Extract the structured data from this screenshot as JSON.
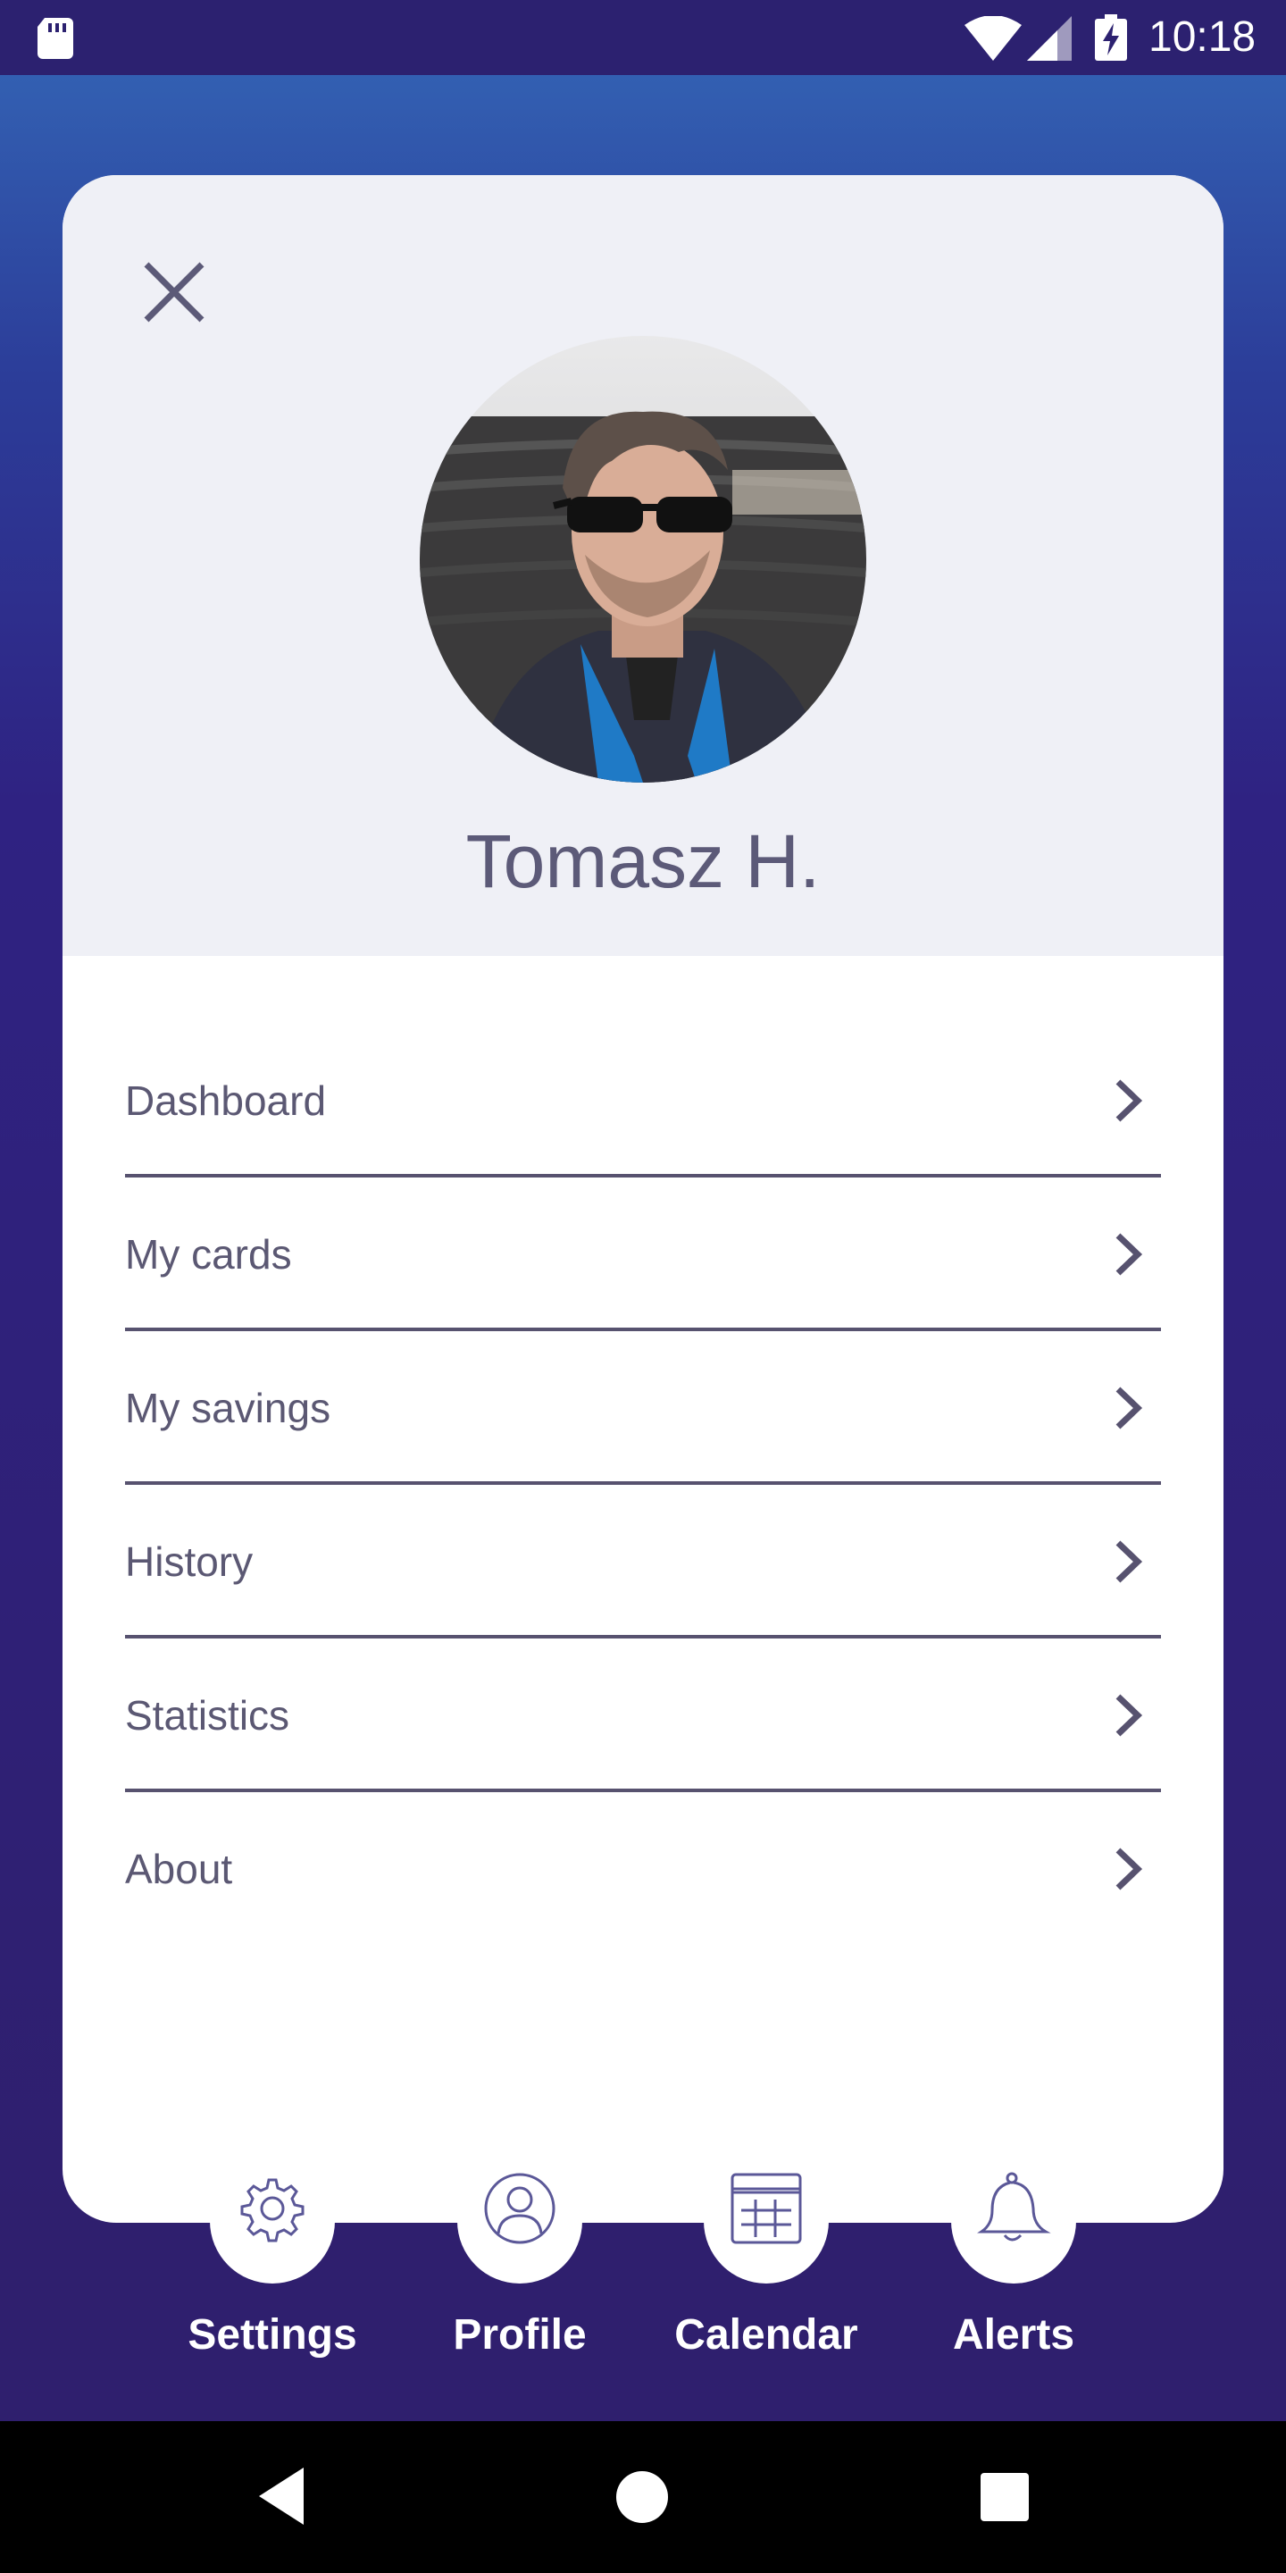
{
  "status_bar": {
    "time": "10:18",
    "icons": [
      "sd-card-icon",
      "wifi-icon",
      "signal-icon",
      "battery-charging-icon"
    ]
  },
  "drawer": {
    "close_icon": "close-icon",
    "user_name": "Tomasz H.",
    "menu": [
      {
        "label": "Dashboard"
      },
      {
        "label": "My cards"
      },
      {
        "label": "My savings"
      },
      {
        "label": "History"
      },
      {
        "label": "Statistics"
      },
      {
        "label": "About"
      }
    ]
  },
  "bottom_nav": [
    {
      "label": "Settings",
      "icon": "gear-icon"
    },
    {
      "label": "Profile",
      "icon": "user-icon"
    },
    {
      "label": "Calendar",
      "icon": "calendar-icon"
    },
    {
      "label": "Alerts",
      "icon": "bell-icon"
    }
  ],
  "system_nav": [
    "back-icon",
    "home-icon",
    "recents-icon"
  ],
  "colors": {
    "accent": "#2f1f6e",
    "text": "#5b5873",
    "header_bg": "#eff0f6"
  }
}
